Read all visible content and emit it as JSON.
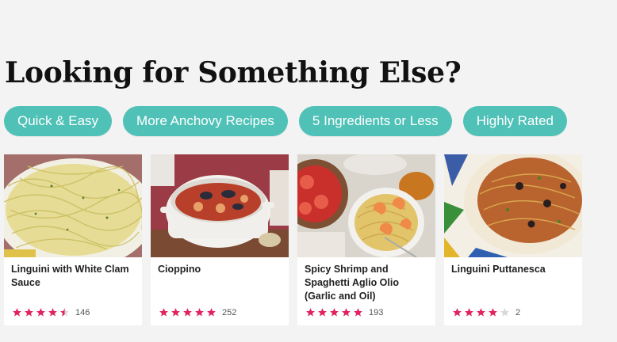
{
  "heading": "Looking for Something Else?",
  "pills": [
    {
      "label": "Quick & Easy"
    },
    {
      "label": "More Anchovy Recipes"
    },
    {
      "label": "5 Ingredients or Less"
    },
    {
      "label": "Highly Rated"
    }
  ],
  "colors": {
    "accent": "#4fc1b7",
    "star": "#e0245e",
    "star_empty": "#d9d9d9"
  },
  "cards": [
    {
      "title": "Linguini with White Clam Sauce",
      "rating": 4.5,
      "count": "146"
    },
    {
      "title": "Cioppino",
      "rating": 5,
      "count": "252"
    },
    {
      "title": "Spicy Shrimp and Spaghetti Aglio Olio (Garlic and Oil)",
      "rating": 5,
      "count": "193"
    },
    {
      "title": "Linguini Puttanesca",
      "rating": 4,
      "count": "2"
    }
  ]
}
